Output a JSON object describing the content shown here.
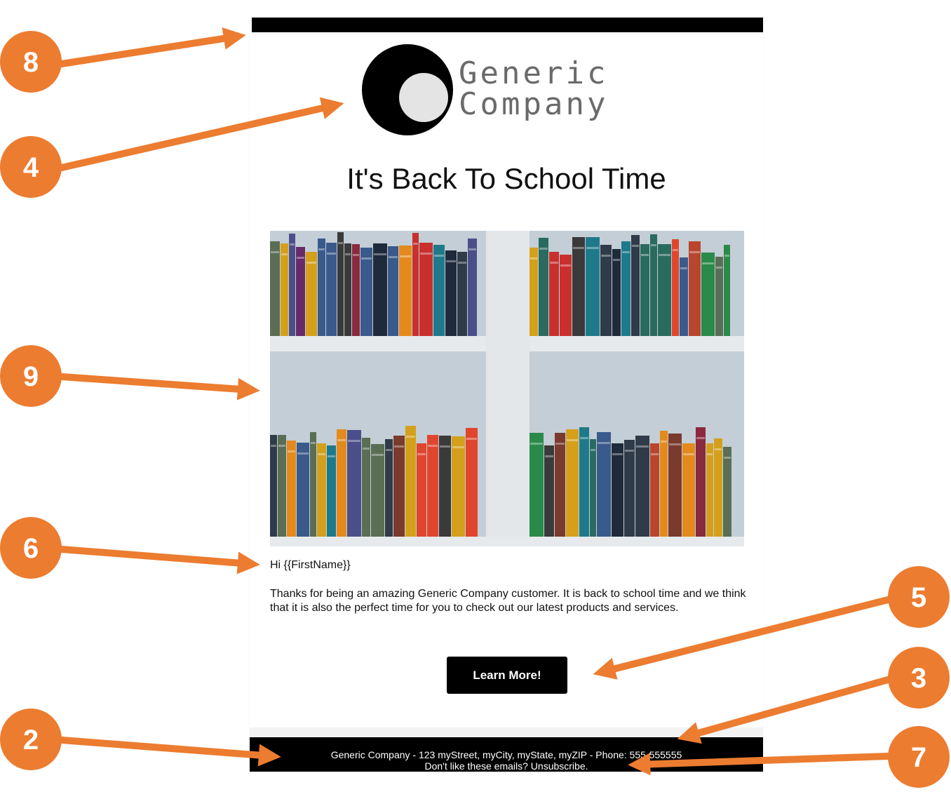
{
  "email": {
    "logo": {
      "line1": "Generic",
      "line2": "Company"
    },
    "headline": "It's Back To School Time",
    "greeting": "Hi {{FirstName}}",
    "body": "Thanks for being an amazing Generic Company customer. It is back to school time and we think that it is also the perfect time for you to check out our latest products and services.",
    "cta_label": "Learn More!",
    "footer": {
      "address": "Generic Company - 123 myStreet, myCity, myState, myZIP - Phone: 555-555555",
      "unsubscribe_prompt": "Don't like these emails?",
      "unsubscribe_link": "Unsubscribe."
    }
  },
  "callouts": [
    {
      "number": "8"
    },
    {
      "number": "4"
    },
    {
      "number": "9"
    },
    {
      "number": "6"
    },
    {
      "number": "5"
    },
    {
      "number": "3"
    },
    {
      "number": "2"
    },
    {
      "number": "7"
    }
  ],
  "colors": {
    "accent": "#ec7c30",
    "bar": "#000000",
    "text": "#111111"
  }
}
